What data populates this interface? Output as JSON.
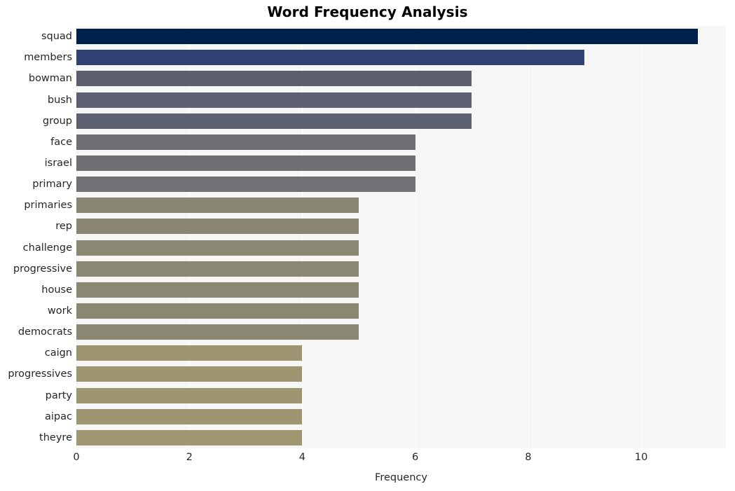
{
  "chart_data": {
    "type": "bar",
    "orientation": "horizontal",
    "title": "Word Frequency Analysis",
    "xlabel": "Frequency",
    "ylabel": "",
    "categories": [
      "squad",
      "members",
      "bowman",
      "bush",
      "group",
      "face",
      "israel",
      "primary",
      "primaries",
      "rep",
      "challenge",
      "progressive",
      "house",
      "work",
      "democrats",
      "caign",
      "progressives",
      "party",
      "aipac",
      "theyre"
    ],
    "values": [
      11,
      9,
      7,
      7,
      7,
      6,
      6,
      6,
      5,
      5,
      5,
      5,
      5,
      5,
      5,
      4,
      4,
      4,
      4,
      4
    ],
    "bar_colors": [
      "#00214d",
      "#2f4271",
      "#5b5f6f",
      "#5c6070",
      "#5c6070",
      "#6e6f72",
      "#6f7073",
      "#6f7174",
      "#888671",
      "#898771",
      "#8a8872",
      "#8a8872",
      "#8a8872",
      "#8a8872",
      "#8a8873",
      "#9d9470",
      "#9e9571",
      "#9e9571",
      "#9e9571",
      "#9f9672"
    ],
    "xticks": [
      0,
      2,
      4,
      6,
      8,
      10
    ],
    "xtick_labels": [
      "0",
      "2",
      "4",
      "6",
      "8",
      "10"
    ],
    "xlim": [
      0,
      11.5
    ],
    "grid": true,
    "grid_axis": "x",
    "legend": "none",
    "plot_background": "#f6f6f7",
    "figure_background": "#ffffff",
    "text_color": "#262626"
  }
}
